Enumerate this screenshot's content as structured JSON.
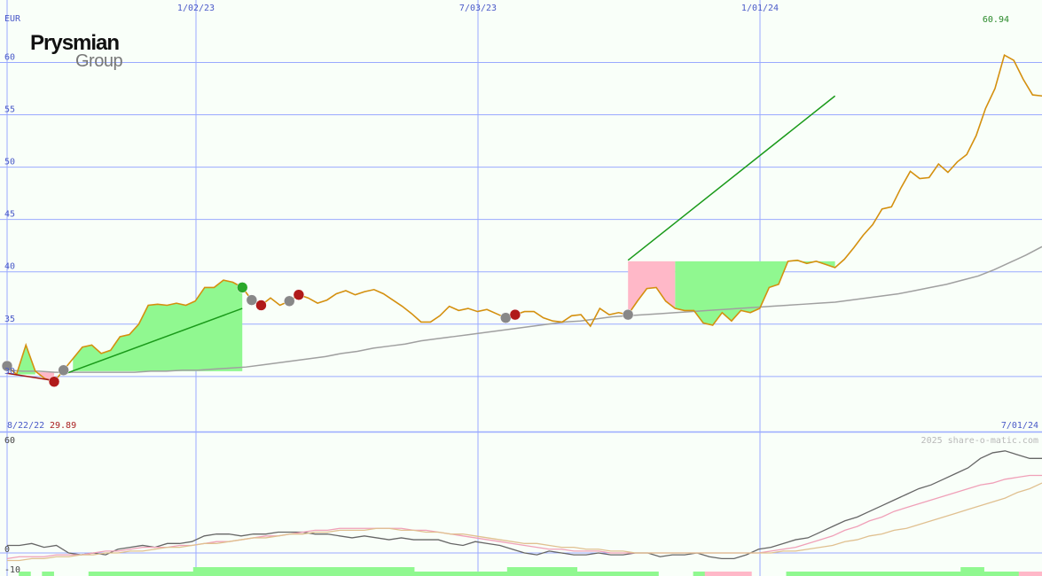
{
  "company": {
    "name": "Prysmian",
    "group": "Group"
  },
  "credit": "2025 share-o-matic.com",
  "currency": "EUR",
  "colors": {
    "background": "#f9fff9",
    "grid": "#9aaaff",
    "price_line": "#d4900f",
    "gain_fill": "#90f890",
    "loss_fill": "#ffb8c8",
    "trend_up": "#1a9a1a",
    "trend_down": "#a01818",
    "moving_average": "#a0a0a0",
    "axis_text": "#4a5ac8",
    "high_text": "#2a8a2a",
    "low_text": "#aa2222"
  },
  "chart_data": [
    {
      "type": "line",
      "title": "",
      "y_unit": "EUR",
      "ylim": [
        25,
        65
      ],
      "y_ticks": [
        30,
        35,
        40,
        45,
        50,
        55,
        60
      ],
      "x_tick_labels": [
        "1/02/23",
        "7/03/23",
        "1/01/24"
      ],
      "start_label": "8/22/22",
      "end_label": "7/01/24",
      "low_label": "29.89",
      "high_label": "60.94",
      "series": [
        {
          "values": [
            31,
            30.2,
            33,
            30.5,
            29.8,
            29.5,
            30.6,
            31.7,
            32.8,
            33,
            32.2,
            32.5,
            33.8,
            34,
            35,
            36.8,
            36.9,
            36.8,
            37,
            36.8,
            37.2,
            38.5,
            38.5,
            39.2,
            39,
            38.5,
            37.3,
            36.8,
            37.5,
            36.8,
            37.2,
            37.8,
            37.5,
            37,
            37.3,
            37.9,
            38.2,
            37.8,
            38.1,
            38.3,
            37.9,
            37.3,
            36.7,
            36,
            35.2,
            35.2,
            35.8,
            36.7,
            36.3,
            36.5,
            36.2,
            36.4,
            36,
            35.6,
            35.9,
            36.2,
            36.2,
            35.6,
            35.3,
            35.2,
            35.8,
            35.9,
            34.8,
            36.5,
            35.9,
            36.1,
            35.9,
            37.2,
            38.4,
            38.5,
            37.2,
            36.5,
            36.3,
            36.3,
            35.1,
            34.9,
            36.1,
            35.3,
            36.3,
            36.1,
            36.5,
            38.5,
            38.8,
            41,
            41.1,
            40.8,
            41,
            40.7,
            40.4,
            41.2,
            42.3,
            43.5,
            44.5,
            46,
            46.2,
            48,
            49.6,
            48.9,
            49,
            50.3,
            49.5,
            50.5,
            51.2,
            53,
            55.6,
            57.5,
            60.7,
            60.2,
            58.4,
            56.9,
            56.8
          ]
        }
      ],
      "trend_lines": [
        {
          "direction": "down",
          "from": [
            0,
            30.3
          ],
          "to": [
            5,
            29.6
          ]
        },
        {
          "direction": "up",
          "from": [
            6,
            30.2
          ],
          "to": [
            25,
            36.5
          ]
        },
        {
          "direction": "up",
          "from": [
            66,
            41.1
          ],
          "to": [
            88,
            56.8
          ]
        }
      ],
      "gain_regions": [
        {
          "from": 1,
          "to": 3,
          "base": 30.2
        },
        {
          "from": 7,
          "to": 25,
          "base": 30.5
        },
        {
          "from": 71,
          "to": 88,
          "base": 41
        }
      ],
      "loss_regions": [
        {
          "from": 3,
          "to": 5,
          "base": 30.4
        },
        {
          "from": 66,
          "to": 71,
          "base": 41
        }
      ],
      "signals": [
        {
          "index": 0,
          "kind": "neutral"
        },
        {
          "index": 5,
          "kind": "sell"
        },
        {
          "index": 6,
          "kind": "neutral"
        },
        {
          "index": 25,
          "kind": "buy"
        },
        {
          "index": 26,
          "kind": "neutral"
        },
        {
          "index": 27,
          "kind": "sell"
        },
        {
          "index": 30,
          "kind": "neutral"
        },
        {
          "index": 31,
          "kind": "sell"
        },
        {
          "index": 53,
          "kind": "neutral"
        },
        {
          "index": 54,
          "kind": "sell"
        },
        {
          "index": 66,
          "kind": "neutral"
        }
      ],
      "moving_average": {
        "values": [
          30.6,
          30.5,
          30.5,
          30.4,
          30.4,
          30.4,
          30.4,
          30.4,
          30.4,
          30.5,
          30.5,
          30.6,
          30.6,
          30.7,
          30.8,
          30.9,
          31.1,
          31.3,
          31.5,
          31.7,
          31.9,
          32.2,
          32.4,
          32.7,
          32.9,
          33.1,
          33.4,
          33.6,
          33.8,
          34.0,
          34.2,
          34.4,
          34.6,
          34.8,
          35.0,
          35.2,
          35.3,
          35.5,
          35.7,
          35.8,
          35.9,
          36.0,
          36.1,
          36.2,
          36.3,
          36.4,
          36.5,
          36.6,
          36.7,
          36.8,
          36.9,
          37.0,
          37.1,
          37.3,
          37.5,
          37.7,
          37.9,
          38.2,
          38.5,
          38.8,
          39.2,
          39.6,
          40.2,
          40.9,
          41.6,
          42.4
        ]
      }
    },
    {
      "type": "line",
      "title": "",
      "ylim": [
        -10,
        60
      ],
      "y_ticks": [
        60,
        0,
        -10
      ],
      "series": [
        {
          "values": [
            4,
            4,
            5,
            3,
            4,
            0,
            -1,
            0,
            -1,
            2,
            3,
            4,
            3,
            5,
            5,
            6,
            9,
            10,
            10,
            9,
            10,
            10,
            11,
            11,
            11,
            10,
            10,
            9,
            8,
            9,
            8,
            7,
            8,
            7,
            7,
            7,
            5,
            4,
            6,
            5,
            4,
            2,
            0,
            -1,
            1,
            0,
            -1,
            -1,
            0,
            -1,
            -1,
            0,
            0,
            -2,
            -1,
            -1,
            0,
            -2,
            -3,
            -3,
            -1,
            2,
            3,
            5,
            7,
            8,
            11,
            14,
            17,
            19,
            22,
            25,
            28,
            31,
            34,
            36,
            39,
            42,
            45,
            50,
            53,
            54,
            52,
            50,
            50
          ]
        },
        {
          "values": [
            -3,
            -2,
            -2,
            -2,
            -1,
            -1,
            -1,
            0,
            1,
            1,
            2,
            3,
            3,
            3,
            4,
            4,
            5,
            6,
            6,
            7,
            8,
            9,
            9,
            10,
            11,
            12,
            12,
            13,
            13,
            13,
            13,
            13,
            13,
            12,
            12,
            11,
            10,
            9,
            8,
            7,
            6,
            5,
            4,
            3,
            2,
            2,
            1,
            1,
            1,
            0,
            0,
            0,
            0,
            0,
            0,
            0,
            0,
            0,
            0,
            0,
            0,
            0,
            1,
            2,
            3,
            5,
            7,
            9,
            12,
            14,
            17,
            19,
            22,
            24,
            26,
            28,
            30,
            32,
            34,
            36,
            37,
            39,
            40,
            41,
            41
          ]
        },
        {
          "values": [
            -4,
            -4,
            -3,
            -3,
            -2,
            -2,
            -1,
            -1,
            0,
            0,
            1,
            1,
            2,
            3,
            3,
            4,
            5,
            5,
            6,
            7,
            8,
            8,
            9,
            10,
            10,
            11,
            11,
            12,
            12,
            12,
            13,
            13,
            12,
            12,
            11,
            11,
            10,
            10,
            9,
            8,
            7,
            6,
            5,
            5,
            4,
            3,
            3,
            2,
            2,
            1,
            1,
            0,
            0,
            0,
            0,
            0,
            0,
            0,
            0,
            0,
            0,
            0,
            0,
            1,
            1,
            2,
            3,
            4,
            6,
            7,
            9,
            10,
            12,
            13,
            15,
            17,
            19,
            21,
            23,
            25,
            27,
            29,
            32,
            34,
            37
          ]
        }
      ],
      "volume_bars": [
        0,
        1,
        0,
        1,
        0,
        0,
        0,
        1,
        1,
        1,
        1,
        1,
        1,
        1,
        1,
        1,
        2,
        2,
        2,
        2,
        2,
        2,
        2,
        2,
        2,
        2,
        2,
        2,
        2,
        2,
        2,
        2,
        2,
        2,
        2,
        1,
        1,
        1,
        1,
        1,
        1,
        1,
        1,
        2,
        2,
        2,
        2,
        2,
        2,
        1,
        1,
        1,
        1,
        1,
        1,
        1,
        0,
        0,
        0,
        1,
        1,
        1,
        1,
        1,
        0,
        0,
        0,
        1,
        1,
        1,
        1,
        1,
        1,
        1,
        1,
        1,
        1,
        1,
        1,
        1,
        1,
        1,
        2,
        2,
        1,
        1,
        1,
        1,
        1
      ]
    }
  ]
}
